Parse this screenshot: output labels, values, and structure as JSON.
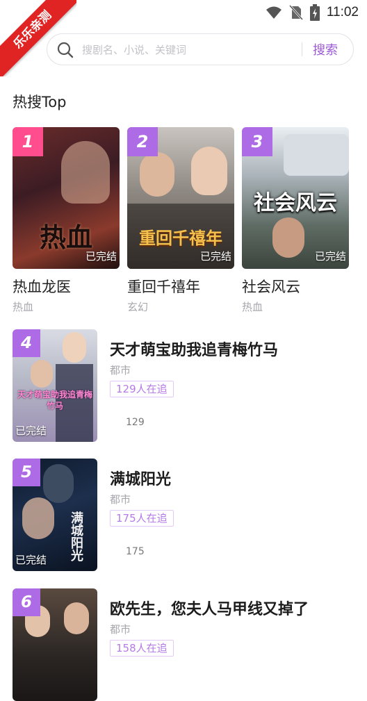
{
  "ribbon": {
    "label": "乐乐亲测"
  },
  "status_bar": {
    "time": "11:02"
  },
  "search": {
    "placeholder": "搜剧名、小说、关键词",
    "button_label": "搜索"
  },
  "hot_section": {
    "title": "热搜Top",
    "top_cards": [
      {
        "rank": "1",
        "title": "热血龙医",
        "genre": "热血",
        "status": "已完结",
        "cover_text": "热血"
      },
      {
        "rank": "2",
        "title": "重回千禧年",
        "genre": "玄幻",
        "status": "已完结",
        "cover_text": "重回千禧年"
      },
      {
        "rank": "3",
        "title": "社会风云",
        "genre": "热血",
        "status": "已完结",
        "cover_text": "社会风云"
      }
    ],
    "list_items": [
      {
        "rank": "4",
        "title": "天才萌宝助我追青梅竹马",
        "genre": "都市",
        "chasing": "129人在追",
        "count": "129",
        "status": "已完结",
        "cover_text": "天才萌宝助我追青梅竹马"
      },
      {
        "rank": "5",
        "title": "满城阳光",
        "genre": "都市",
        "chasing": "175人在追",
        "count": "175",
        "status": "已完结",
        "cover_text": "满城阳光"
      },
      {
        "rank": "6",
        "title": "欧先生，您夫人马甲线又掉了",
        "genre": "都市",
        "chasing": "158人在追",
        "count": "",
        "status": "",
        "cover_text": ""
      }
    ]
  },
  "colors": {
    "accent": "#9b59d6",
    "rank_badge": "#ad6be6",
    "rank_badge_first": "#ff4d8d",
    "ribbon": "#e02424"
  }
}
